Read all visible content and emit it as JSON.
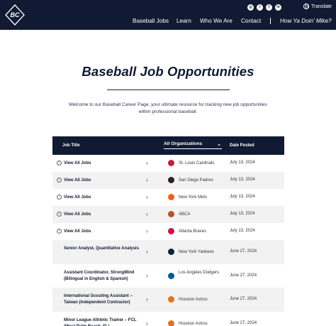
{
  "brand": {
    "logo_text": "BC"
  },
  "header": {
    "social_icons": [
      "instagram-icon",
      "twitter-icon",
      "facebook-icon",
      "linkedin-icon"
    ],
    "translate_label": "Translate",
    "nav": [
      "Baseball Jobs",
      "Learn",
      "Who We Are",
      "Contact"
    ],
    "nav_highlight": "How Ya Doin' Mike?"
  },
  "hero": {
    "title": "Baseball Job Opportunities",
    "intro": "Welcome to our Baseball Career Page, your ultimate resource for tracking new job opportunities within professional baseball."
  },
  "table": {
    "headers": {
      "job": "Job Title",
      "org_filter": "All Organizations",
      "date": "Date Posted"
    },
    "rows": [
      {
        "title": "View All Jobs",
        "org": "St. Louis Cardinals",
        "date": "July 13, 2024",
        "info": true,
        "logo_color": "#c41e3a"
      },
      {
        "title": "View All Jobs",
        "org": "San Diego Padres",
        "date": "July 13, 2024",
        "info": true,
        "logo_color": "#2f241d"
      },
      {
        "title": "View All Jobs",
        "org": "New York Mets",
        "date": "July 13, 2024",
        "info": true,
        "logo_color": "#ff5910"
      },
      {
        "title": "View All Jobs",
        "org": "ABCA",
        "date": "July 13, 2024",
        "info": true,
        "logo_color": "#b5532a"
      },
      {
        "title": "View All Jobs",
        "org": "Atlanta Braves",
        "date": "July 13, 2024",
        "info": true,
        "logo_color": "#ce1141"
      },
      {
        "title": "Senior Analyst, Quantitative Analysis",
        "org": "New York Yankees",
        "date": "June 27, 2024",
        "info": false,
        "logo_color": "#0c2340"
      },
      {
        "title": "Assistant Coordinator, StrongMind (Bilingual in English & Spanish)",
        "org": "Los Angeles Dodgers",
        "date": "June 27, 2024",
        "info": false,
        "logo_color": "#005a9c"
      },
      {
        "title": "International Scouting Assistant – Taiwan (Independent Contractor)",
        "org": "Houston Astros",
        "date": "June 27, 2024",
        "info": false,
        "logo_color": "#eb6e1f"
      },
      {
        "title": "Minor League Athletic Trainer – FCL (West Palm Beach, FL)",
        "org": "Houston Astros",
        "date": "June 27, 2024",
        "info": false,
        "logo_color": "#eb6e1f"
      }
    ]
  }
}
